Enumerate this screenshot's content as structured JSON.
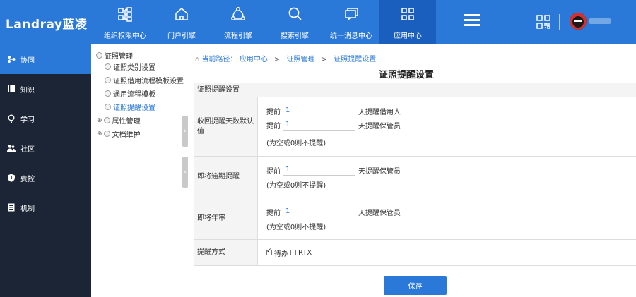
{
  "app": {
    "logo_text": "Landray蓝凌"
  },
  "topnav": {
    "items": [
      {
        "label": "组织权限中心",
        "icon": "org-chart-icon"
      },
      {
        "label": "门户引擎",
        "icon": "home-icon"
      },
      {
        "label": "流程引擎",
        "icon": "workflow-icon"
      },
      {
        "label": "搜索引擎",
        "icon": "search-icon"
      },
      {
        "label": "统一消息中心",
        "icon": "message-icon"
      },
      {
        "label": "应用中心",
        "icon": "grid-icon"
      }
    ],
    "active_index": 5
  },
  "sidebar": {
    "items": [
      {
        "label": "协同",
        "icon": "collaboration-icon"
      },
      {
        "label": "知识",
        "icon": "book-icon"
      },
      {
        "label": "学习",
        "icon": "bulb-icon"
      },
      {
        "label": "社区",
        "icon": "people-icon"
      },
      {
        "label": "费控",
        "icon": "shield-icon"
      },
      {
        "label": "机制",
        "icon": "document-icon"
      }
    ],
    "active_index": 0
  },
  "tree": {
    "root": "证照管理",
    "children": [
      "证照类别设置",
      "证照借用流程模板设置",
      "通用流程模板",
      "证照提醒设置"
    ],
    "siblings": [
      "属性管理",
      "文档维护"
    ],
    "selected": "证照提醒设置"
  },
  "breadcrumb": {
    "prefix": "当前路径：",
    "items": [
      "应用中心",
      "证照管理",
      "证照提醒设置"
    ]
  },
  "page": {
    "title": "证照提醒设置"
  },
  "form": {
    "section": "证照提醒设置",
    "rows": [
      {
        "label": "收回提醒天数默认值",
        "lines": [
          {
            "prefix": "提前",
            "value": "1",
            "suffix": "天提醒借用人"
          },
          {
            "prefix": "提前",
            "value": "1",
            "suffix": "天提醒保管员"
          }
        ],
        "hint": "(为空或0则不提醒)"
      },
      {
        "label": "即将逾期提醒",
        "lines": [
          {
            "prefix": "提前",
            "value": "1",
            "suffix": "天提醒保管员"
          }
        ],
        "hint": "(为空或0则不提醒)"
      },
      {
        "label": "即将年审",
        "lines": [
          {
            "prefix": "提前",
            "value": "1",
            "suffix": "天提醒保管员"
          }
        ],
        "hint": "(为空或0则不提醒)"
      }
    ],
    "method": {
      "label": "提醒方式",
      "options": [
        {
          "label": "待办",
          "checked": true
        },
        {
          "label": "RTX",
          "checked": false
        }
      ]
    }
  },
  "actions": {
    "save_label": "保存"
  }
}
